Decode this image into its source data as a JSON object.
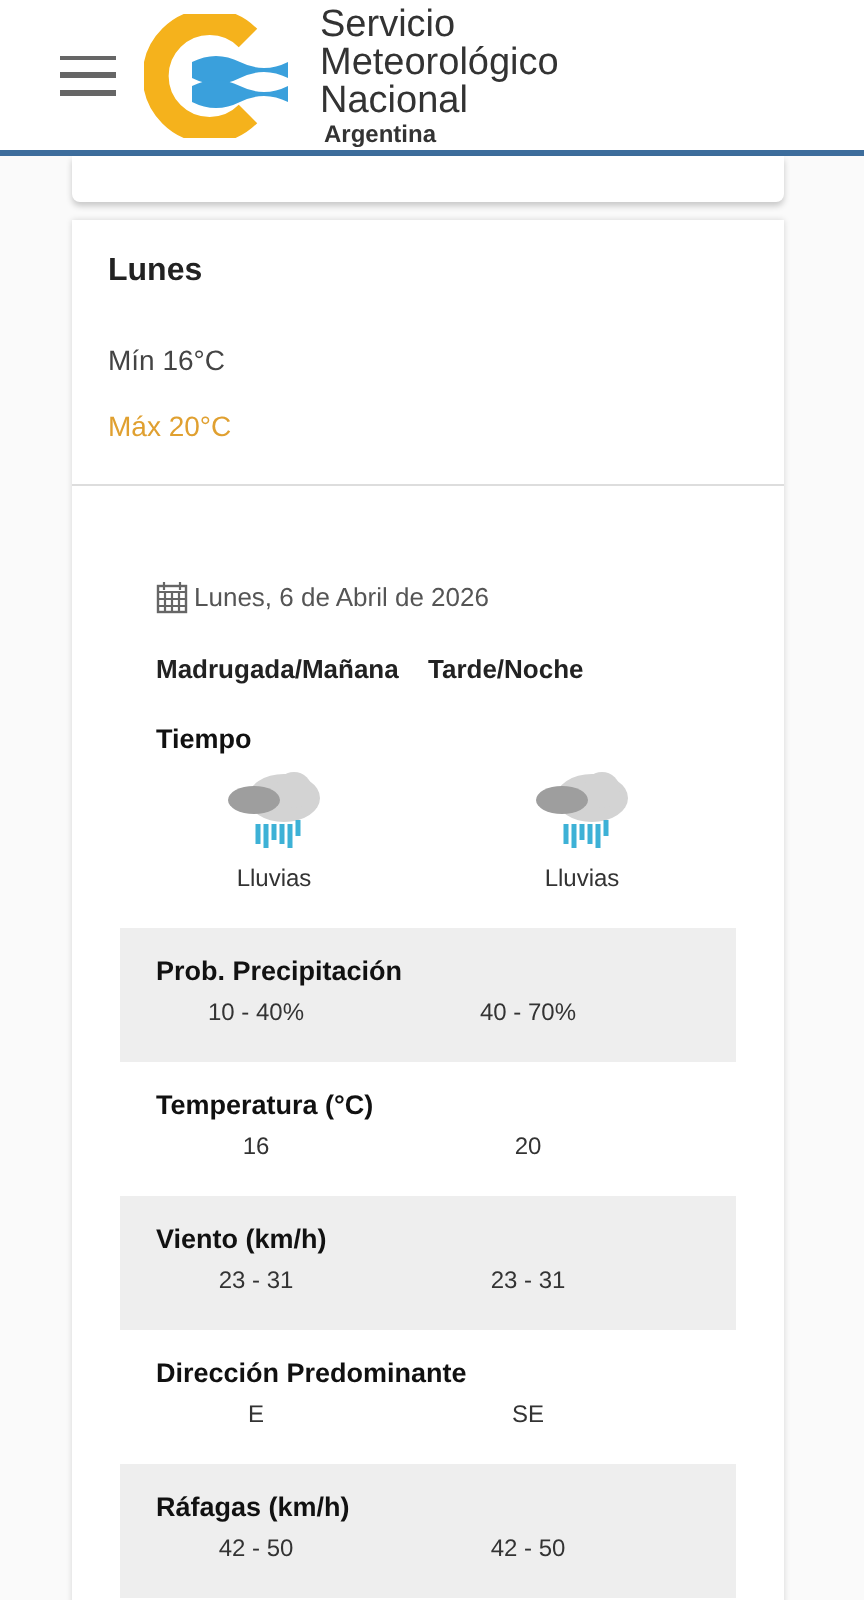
{
  "header": {
    "logo_lines": [
      "Servicio",
      "Meteorológico",
      "Nacional"
    ],
    "logo_country": "Argentina"
  },
  "day": {
    "name": "Lunes",
    "min": "Mín 16°C",
    "max": "Máx 20°C"
  },
  "forecast": {
    "date": "Lunes, 6 de Abril de 2026",
    "periods": [
      "Madrugada/Mañana",
      "Tarde/Noche"
    ],
    "weather": {
      "label": "Tiempo",
      "values": [
        "Lluvias",
        "Lluvias"
      ]
    },
    "rows": [
      {
        "label": "Prob. Precipitación",
        "values": [
          "10 - 40%",
          "40 - 70%"
        ]
      },
      {
        "label": "Temperatura (°C)",
        "values": [
          "16",
          "20"
        ]
      },
      {
        "label": "Viento (km/h)",
        "values": [
          "23 - 31",
          "23 - 31"
        ]
      },
      {
        "label": "Dirección Predominante",
        "values": [
          "E",
          "SE"
        ]
      },
      {
        "label": "Ráfagas (km/h)",
        "values": [
          "42 - 50",
          "42 - 50"
        ]
      }
    ]
  }
}
